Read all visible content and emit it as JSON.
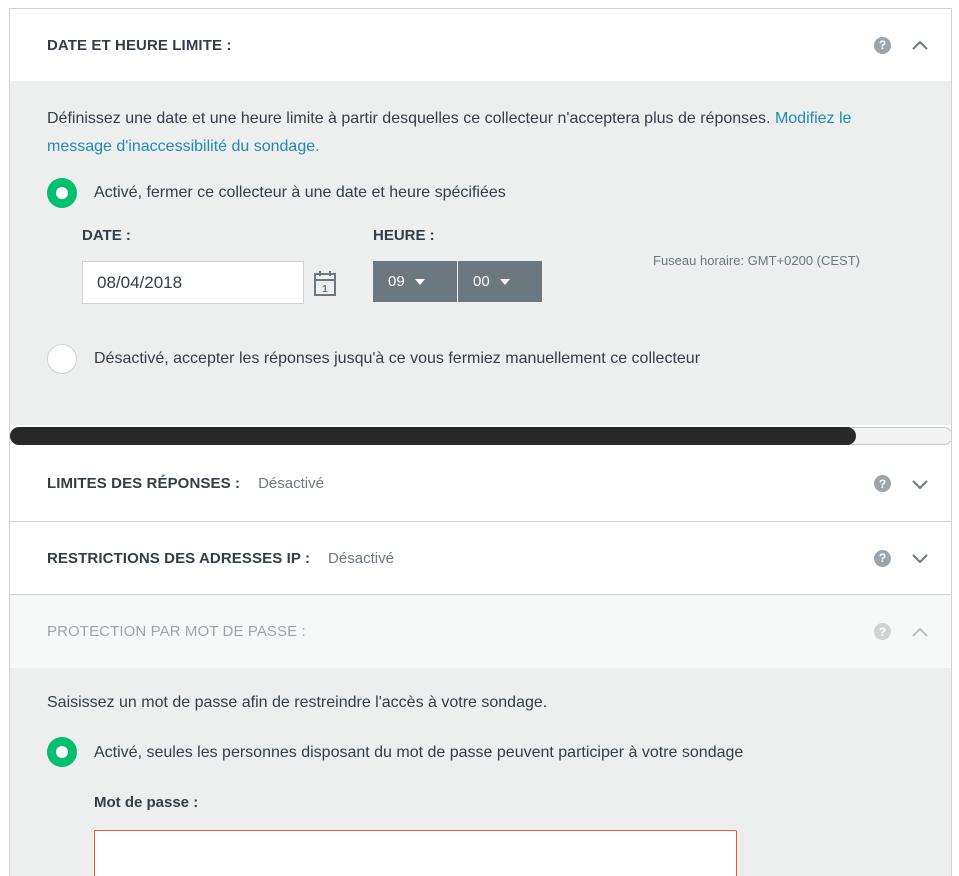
{
  "deadline": {
    "title": "DATE ET HEURE LIMITE :",
    "description": "Définissez une date et une heure limite à partir desquelles ce collecteur n'acceptera plus de réponses.",
    "link_text": "Modifiez le message d'inaccessibilité du sondage.",
    "option_on": "Activé, fermer ce collecteur à une date et heure spécifiées",
    "date_label": "DATE :",
    "date_value": "08/04/2018",
    "time_label": "HEURE :",
    "hour": "09",
    "minute": "00",
    "timezone": "Fuseau horaire: GMT+0200 (CEST)",
    "option_off": "Désactivé, accepter les réponses jusqu'à ce vous fermiez manuellement ce collecteur",
    "selected": "on"
  },
  "response_limits": {
    "title": "LIMITES DES RÉPONSES :",
    "status": "Désactivé"
  },
  "ip_restrictions": {
    "title": "RESTRICTIONS DES ADRESSES IP :",
    "status": "Désactivé"
  },
  "password": {
    "title": "PROTECTION PAR MOT DE PASSE :",
    "description": "Saisissez un mot de passe afin de restreindre l'accès à votre sondage.",
    "option_on": "Activé, seules les personnes disposant du mot de passe peuvent participer à votre sondage",
    "field_label": "Mot de passe :",
    "field_value": ""
  },
  "icons": {
    "help": "?",
    "calendar_day": "1"
  },
  "colors": {
    "accent_green": "#00bf6f",
    "link_blue": "#1f8ab4",
    "panel_bg": "#edeeee",
    "select_bg": "#6b787f",
    "error_border": "#f05b24"
  }
}
